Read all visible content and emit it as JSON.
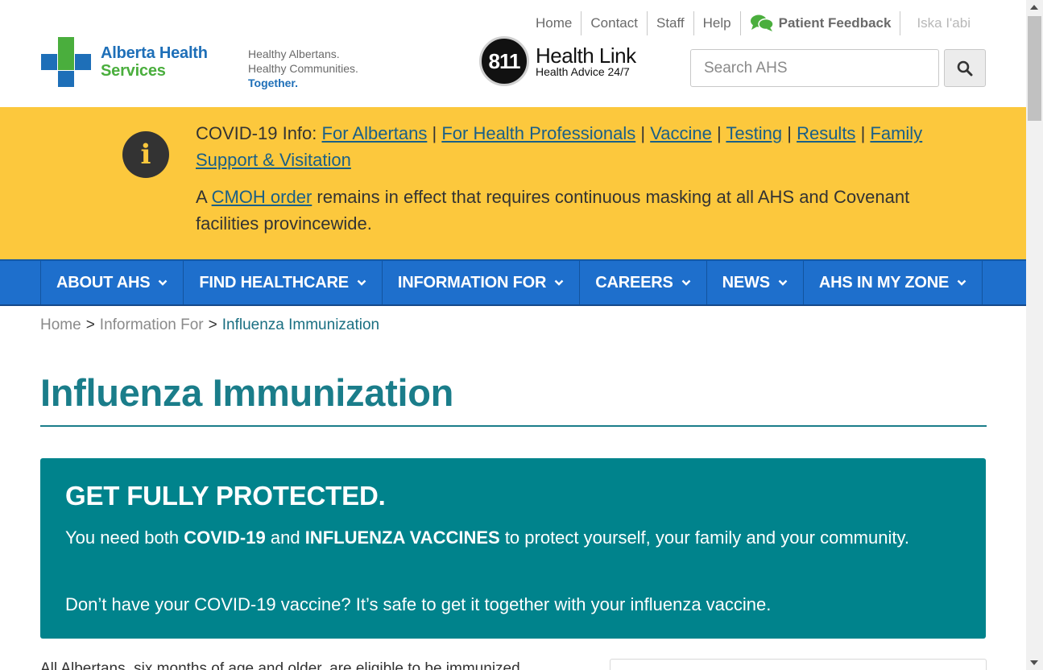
{
  "header": {
    "utility_links": [
      "Home",
      "Contact",
      "Staff",
      "Help"
    ],
    "patient_feedback": "Patient Feedback",
    "language_link": "Iska I'abi",
    "logo": {
      "line1": "Alberta Health",
      "line2": "Services"
    },
    "tagline": {
      "line1": "Healthy Albertans.",
      "line2": "Healthy Communities.",
      "line3": "Together."
    },
    "healthlink": {
      "number": "811",
      "title": "Health Link",
      "subtitle": "Health Advice 24/7"
    },
    "search": {
      "placeholder": "Search AHS",
      "value": ""
    }
  },
  "alert": {
    "prefix": "COVID-19 Info:",
    "links": [
      "For Albertans",
      "For Health Professionals",
      "Vaccine",
      "Testing",
      "Results",
      "Family Support & Visitation"
    ],
    "separator": "|",
    "cmoh_pre": "A",
    "cmoh_link": "CMOH order",
    "cmoh_post": "remains in effect that requires continuous masking at all AHS and Covenant facilities provincewide."
  },
  "nav": {
    "items": [
      "ABOUT AHS",
      "FIND HEALTHCARE",
      "INFORMATION FOR",
      "CAREERS",
      "NEWS",
      "AHS IN MY ZONE"
    ]
  },
  "breadcrumb": {
    "items": [
      "Home",
      "Information For"
    ],
    "current": "Influenza Immunization",
    "separator": ">"
  },
  "page": {
    "title": "Influenza Immunization",
    "promo": {
      "heading": "GET FULLY PROTECTED.",
      "p1_pre": "You need both",
      "p1_b1": "COVID-19",
      "p1_mid": "and",
      "p1_b2": "INFLUENZA VACCINES",
      "p1_post": "to protect yourself, your family and your community.",
      "p2": "Don’t have your COVID-19 vaccine? It’s safe to get it together with your influenza vaccine."
    },
    "body_start": "All Albertans, six months of age and older, are eligible to be immunized"
  },
  "colors": {
    "brand_blue": "#1e6fb8",
    "brand_green": "#4aae3d",
    "alert_yellow": "#fcc83d",
    "nav_blue": "#1e6fcc",
    "teal": "#00838c",
    "title_teal": "#1a7d8a"
  }
}
